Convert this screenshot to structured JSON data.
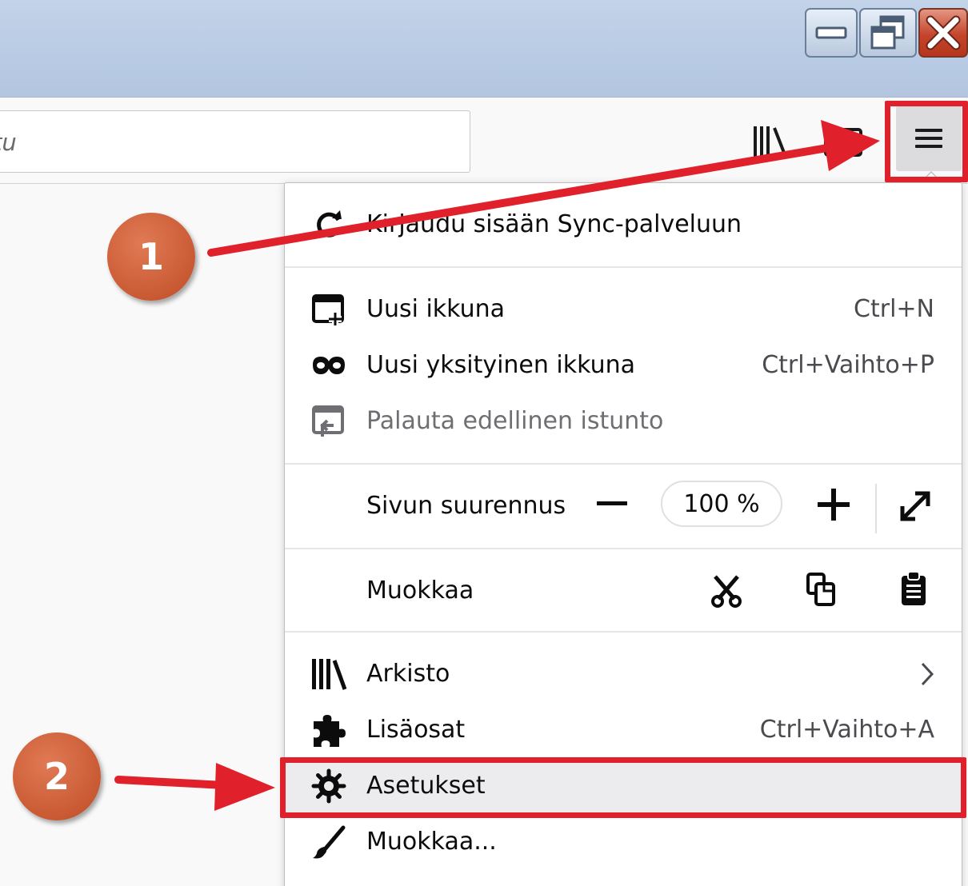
{
  "window": {
    "controls": [
      {
        "name": "minimize-icon"
      },
      {
        "name": "restore-icon"
      },
      {
        "name": "close-icon"
      }
    ]
  },
  "toolbar": {
    "url_text": "tu",
    "library_icon": "library-icon",
    "sidebar_icon": "sidebar-icon",
    "menu_icon": "hamburger-menu-icon"
  },
  "menu": {
    "sync": "Kirjaudu sisään Sync-palveluun",
    "new_window": {
      "label": "Uusi ikkuna",
      "shortcut": "Ctrl+N"
    },
    "private_window": {
      "label": "Uusi yksityinen ikkuna",
      "shortcut": "Ctrl+Vaihto+P"
    },
    "restore_session": {
      "label": "Palauta edellinen istunto"
    },
    "zoom": {
      "label": "Sivun suurennus",
      "value": "100 %"
    },
    "edit": {
      "label": "Muokkaa"
    },
    "library": {
      "label": "Arkisto"
    },
    "addons": {
      "label": "Lisäosat",
      "shortcut": "Ctrl+Vaihto+A"
    },
    "options": {
      "label": "Asetukset"
    },
    "customize": {
      "label": "Muokkaa..."
    }
  },
  "annotations": {
    "step1": "1",
    "step2": "2",
    "color": "#e0202a",
    "badge_color": "#c95a33"
  }
}
